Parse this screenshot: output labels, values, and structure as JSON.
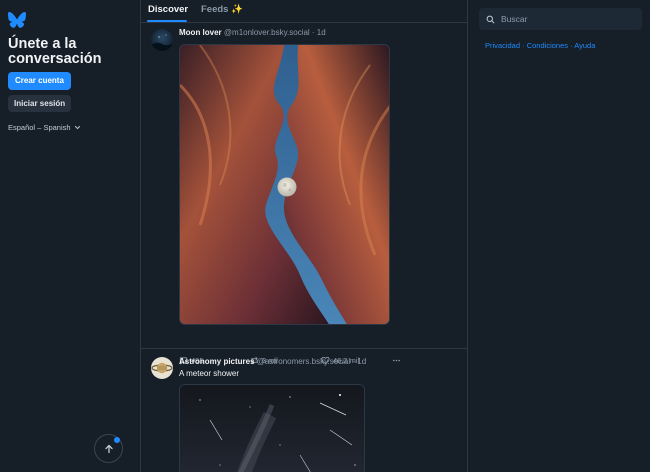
{
  "sidebar": {
    "title": "Únete a la conversación",
    "create_account": "Crear cuenta",
    "sign_in": "Iniciar sesión",
    "language": "Español – Spanish"
  },
  "feed": {
    "tabs": [
      {
        "label": "Discover"
      },
      {
        "label": "Feeds ✨"
      }
    ],
    "posts": [
      {
        "author": "Moon lover",
        "handle": "@m1onlover.bsky.social · 1d",
        "replies": "495",
        "reposts": "3 mil",
        "likes": "46,2 mil"
      },
      {
        "author": "Astronomy pictures",
        "handle": "@astronomers.bsky.social · 1d",
        "text": "A meteor shower"
      }
    ]
  },
  "right": {
    "search_placeholder": "Buscar",
    "links": [
      "Privacidad",
      "Condiciones",
      "Ayuda"
    ],
    "link_separator": "·"
  },
  "colors": {
    "background": "#161e27",
    "accent": "#208bfe",
    "border": "#2e3845",
    "muted_text": "#8c9aa9"
  },
  "icons": [
    "butterfly-logo-icon",
    "chevron-down-icon",
    "arrow-up-icon",
    "reply-icon",
    "repost-icon",
    "heart-icon",
    "more-icon",
    "search-icon"
  ]
}
